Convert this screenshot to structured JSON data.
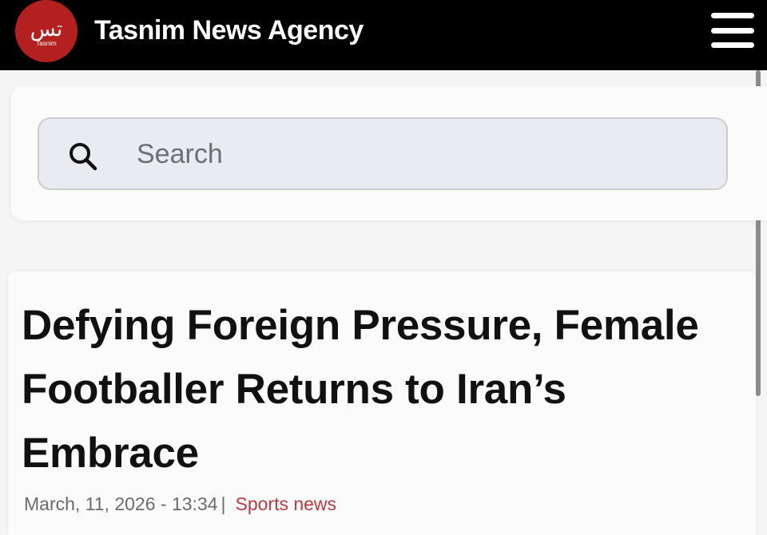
{
  "header": {
    "logo": {
      "glyph": "تس",
      "text": "Tasnim",
      "brand_color": "#b4201f"
    },
    "title": "Tasnim News Agency",
    "menu_icon": "hamburger-menu-icon"
  },
  "search": {
    "icon": "search-icon",
    "placeholder": "Search",
    "value": ""
  },
  "article": {
    "headline": "Defying Foreign Pressure, Female Footballer Returns to Iran’s Embrace",
    "date": "March, 11, 2026 - 13:34",
    "separator": "|",
    "category": "Sports news",
    "category_color": "#b93a3e"
  }
}
